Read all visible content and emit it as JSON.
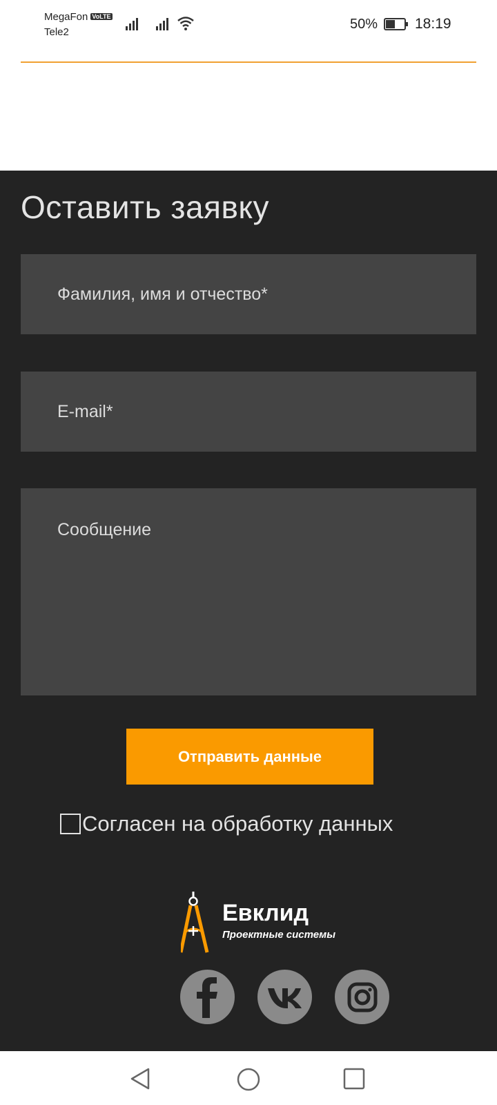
{
  "status_bar": {
    "carrier1": "MegaFon",
    "carrier1_badge": "VoLTE",
    "carrier2": "Tele2",
    "battery_percent": "50%",
    "battery_level": 0.5,
    "time": "18:19"
  },
  "form": {
    "title": "Оставить заявку",
    "name_placeholder": "Фамилия, имя и отчество*",
    "email_placeholder": "E-mail*",
    "message_placeholder": "Сообщение",
    "submit_label": "Отправить данные",
    "consent_label": "Согласен на обработку данных",
    "consent_checked": false
  },
  "footer": {
    "logo_name": "Евклид",
    "logo_tagline": "Проектные системы",
    "socials": [
      "facebook-icon",
      "vk-icon",
      "instagram-icon"
    ]
  },
  "colors": {
    "accent": "#fa9a00",
    "background_dark": "#232323",
    "field_bg": "#444444",
    "social_icon_bg": "#8a8a8a"
  },
  "navigation": {
    "buttons": [
      "back-icon",
      "home-icon",
      "recents-icon"
    ]
  }
}
